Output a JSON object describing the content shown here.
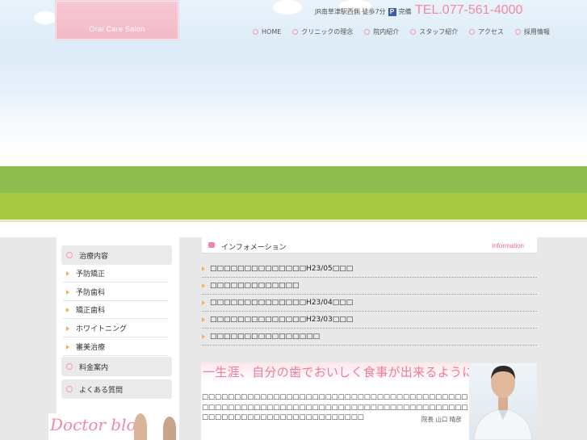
{
  "header": {
    "logo_text": "Oral Care Salon",
    "access": "JR南草津駅西側 徒歩7分",
    "parking_badge": "P",
    "parking_text": "完備",
    "tel": "TEL.077-561-4000"
  },
  "global_nav": [
    "HOME",
    "クリニックの理念",
    "院内紹介",
    "スタッフ紹介",
    "アクセス",
    "採用情報"
  ],
  "side_nav": {
    "main_items": [
      "治療内容",
      "料金案内",
      "よくある質問"
    ],
    "sub_items": [
      "予防矯正",
      "予防歯科",
      "矯正歯科",
      "ホワイトニング",
      "審美治療"
    ],
    "blog_banner": "Doctor blog"
  },
  "information": {
    "title": "インフォメーション",
    "title_en": "information",
    "items": [
      "□□□□□□□□□□□□□□H23/05□□□",
      "□□□□□□□□□□□□□",
      "□□□□□□□□□□□□□□H23/04□□□",
      "□□□□□□□□□□□□□□H23/03□□□",
      "□□□□□□□□□□□□□□□□"
    ]
  },
  "message": {
    "catch": "一生涯、自分の歯でおいしく食事が出来るように。",
    "body": "□□□□□□□□□□□□□□□□□□□□□□□□□□□□□□□□□□□□□□□□□□□□□□□□□□□□□□□□□□□□□□□□□□□□□□□□□□□□□□□□□□□□□□□□□□□□□□□□□□□□□□□□□□□",
    "director": "院長 山口 晴彦"
  },
  "colors": {
    "accent_pink": "#f08aa0",
    "band_green_dark": "#8dbb4e",
    "band_green_light": "#a8c844"
  }
}
